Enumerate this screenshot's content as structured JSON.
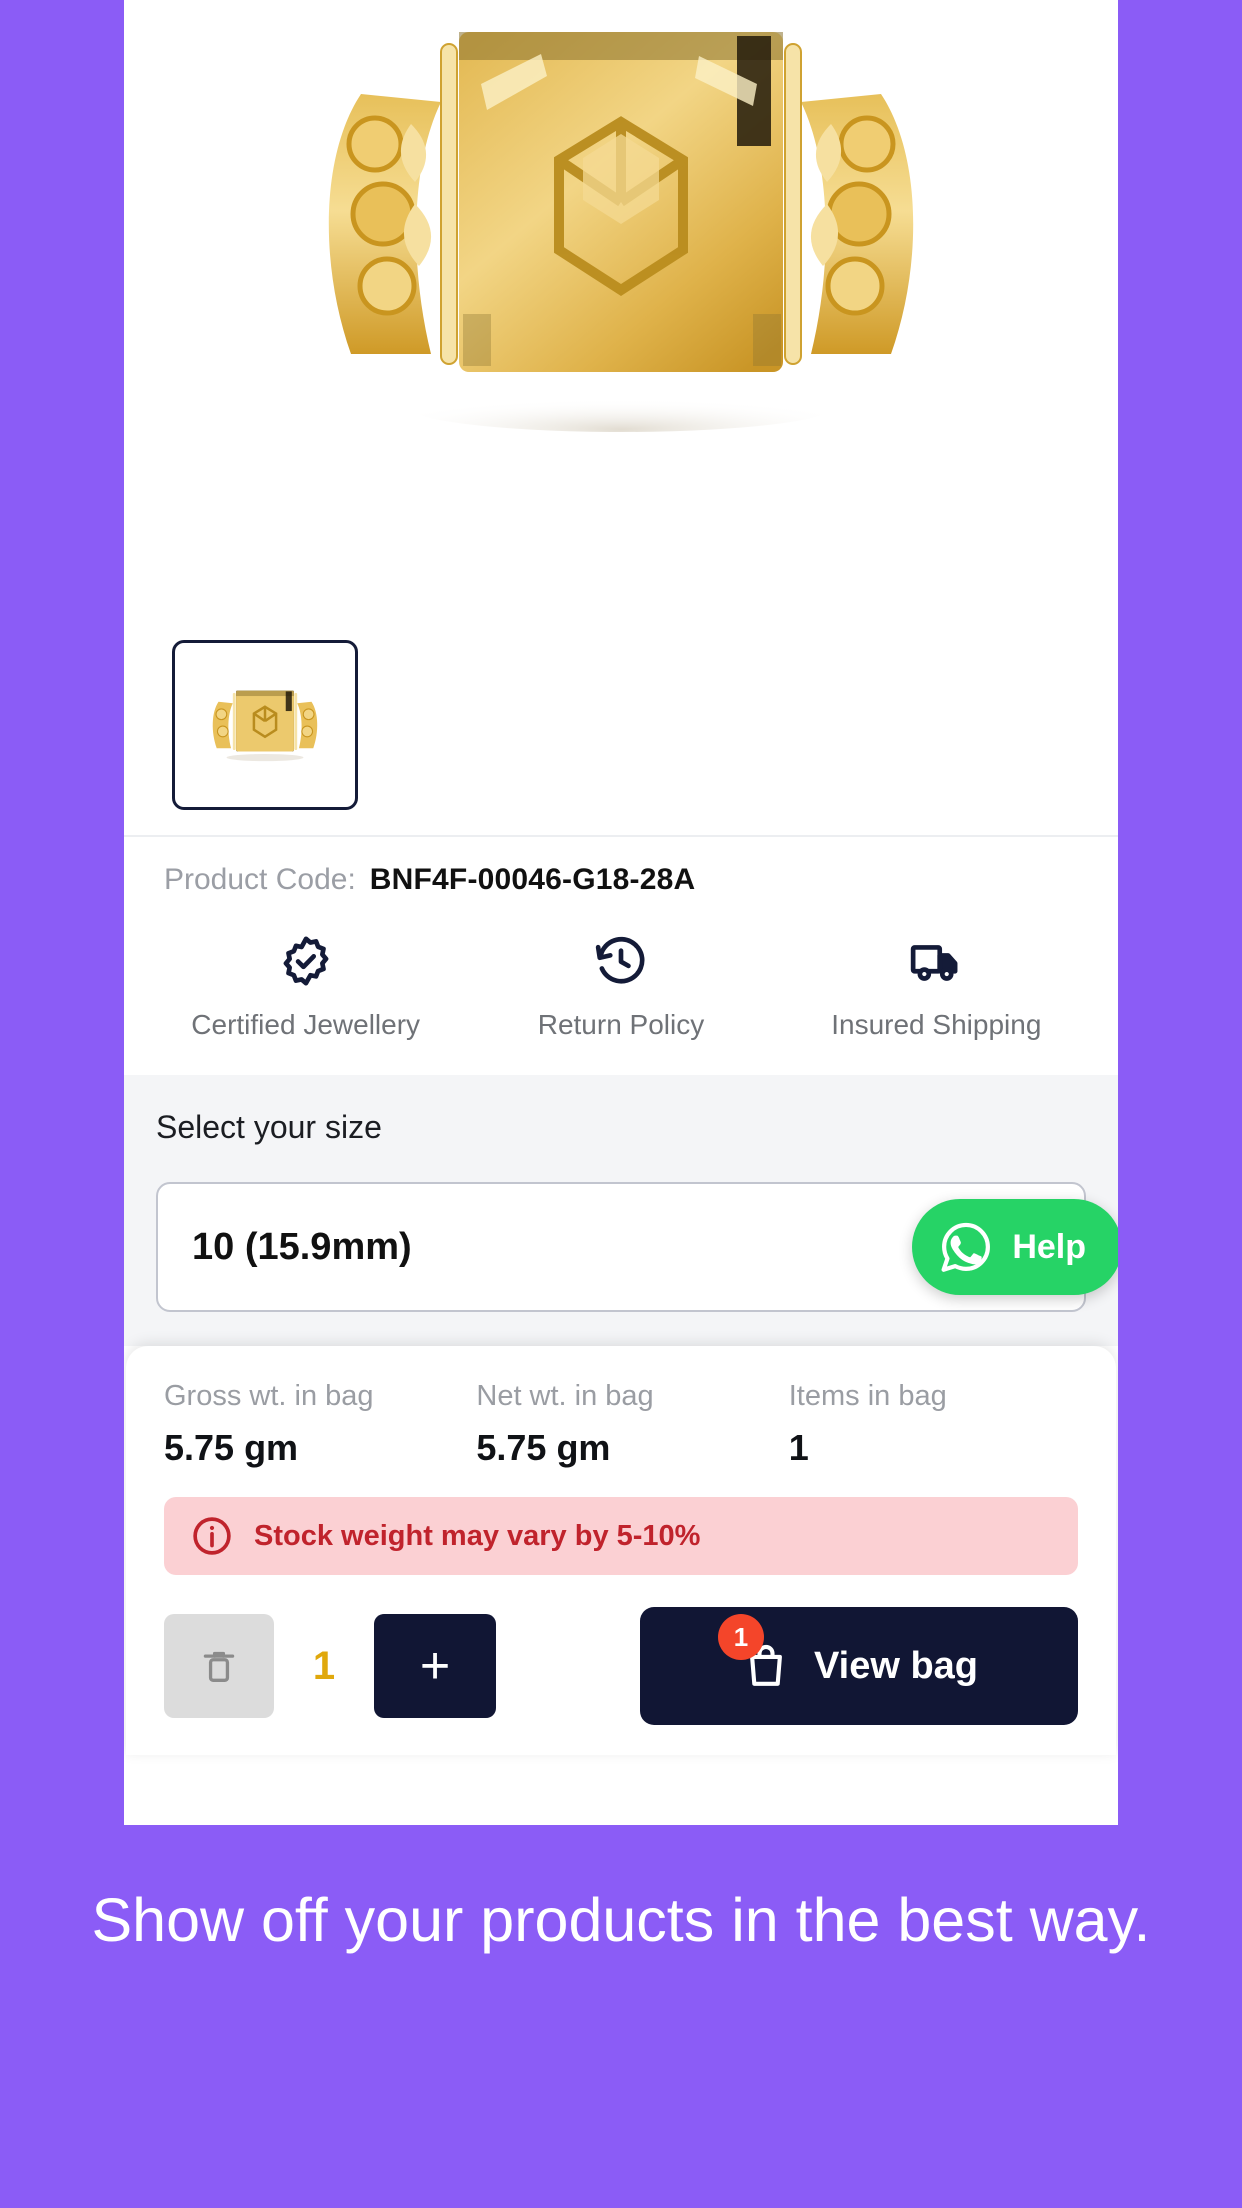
{
  "theme": {
    "background_purple": "#8b5cf6",
    "dark_navy": "#111634",
    "whatsapp_green": "#26d366",
    "warning_red": "#c0232c",
    "warning_bg": "#fbd0d3",
    "qty_gold": "#e0a80c",
    "badge_red": "#f4452a"
  },
  "product": {
    "image_alt": "gold-ring-front-view",
    "thumbnail_alt": "gold-ring-thumbnail",
    "code_label": "Product Code:",
    "code_value": "BNF4F-00046-G18-28A"
  },
  "trust_badges": [
    {
      "icon": "certificate-check-icon",
      "label": "Certified Jewellery"
    },
    {
      "icon": "return-clock-icon",
      "label": "Return Policy"
    },
    {
      "icon": "delivery-truck-icon",
      "label": "Insured Shipping"
    }
  ],
  "size": {
    "heading": "Select your size",
    "selected_value": "10 (15.9mm)",
    "help_button_label": "Help",
    "help_icon": "whatsapp-icon"
  },
  "bag": {
    "columns": [
      {
        "label": "Gross wt. in bag",
        "value": "5.75 gm"
      },
      {
        "label": "Net wt. in bag",
        "value": "5.75 gm"
      },
      {
        "label": "Items in bag",
        "value": "1"
      }
    ],
    "warning": {
      "icon": "info-circle-icon",
      "text": "Stock weight may vary by 5-10%"
    },
    "actions": {
      "delete_icon": "trash-icon",
      "quantity": "1",
      "increment_label": "+",
      "view_bag_label": "View bag",
      "view_bag_icon": "shopping-bag-icon",
      "view_bag_count": "1"
    }
  },
  "caption": {
    "text": "Show off your products in the best way."
  }
}
